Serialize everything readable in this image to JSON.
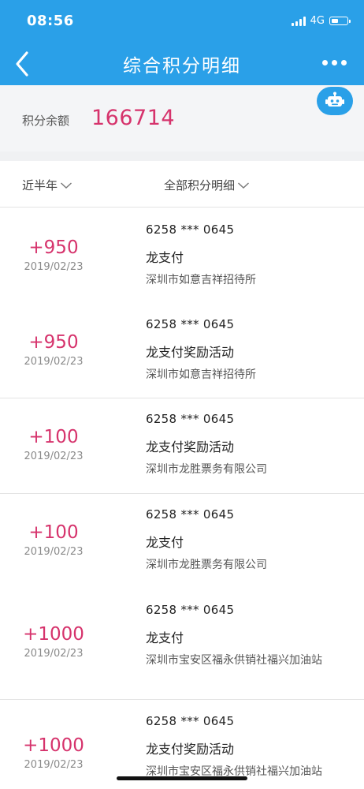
{
  "status_bar": {
    "time": "08:56",
    "network": "4G"
  },
  "nav": {
    "title": "综合积分明细"
  },
  "balance": {
    "label": "积分余额",
    "value": "166714"
  },
  "filters": {
    "period": "近半年",
    "type": "全部积分明细"
  },
  "icons": {
    "back": "chevron-left-icon",
    "more": "more-dots-icon",
    "robot": "robot-assistant-icon",
    "dropdown": "chevron-down-icon"
  },
  "colors": {
    "header": "#2aa0e8",
    "points": "#d6336c",
    "balance_bg": "#f4f5f7"
  },
  "transactions": [
    {
      "points": "+950",
      "date": "2019/02/23",
      "card": "6258 *** 0645",
      "type": "龙支付",
      "merchant": "深圳市如意吉祥招待所"
    },
    {
      "points": "+950",
      "date": "2019/02/23",
      "card": "6258 *** 0645",
      "type": "龙支付奖励活动",
      "merchant": "深圳市如意吉祥招待所"
    },
    {
      "points": "+100",
      "date": "2019/02/23",
      "card": "6258 *** 0645",
      "type": "龙支付奖励活动",
      "merchant": "深圳市龙胜票务有限公司"
    },
    {
      "points": "+100",
      "date": "2019/02/23",
      "card": "6258 *** 0645",
      "type": "龙支付",
      "merchant": "深圳市龙胜票务有限公司"
    },
    {
      "points": "+1000",
      "date": "2019/02/23",
      "card": "6258 *** 0645",
      "type": "龙支付",
      "merchant": "深圳市宝安区福永供销社福兴加油站"
    },
    {
      "points": "+1000",
      "date": "2019/02/23",
      "card": "6258 *** 0645",
      "type": "龙支付奖励活动",
      "merchant": "深圳市宝安区福永供销社福兴加油站"
    }
  ]
}
